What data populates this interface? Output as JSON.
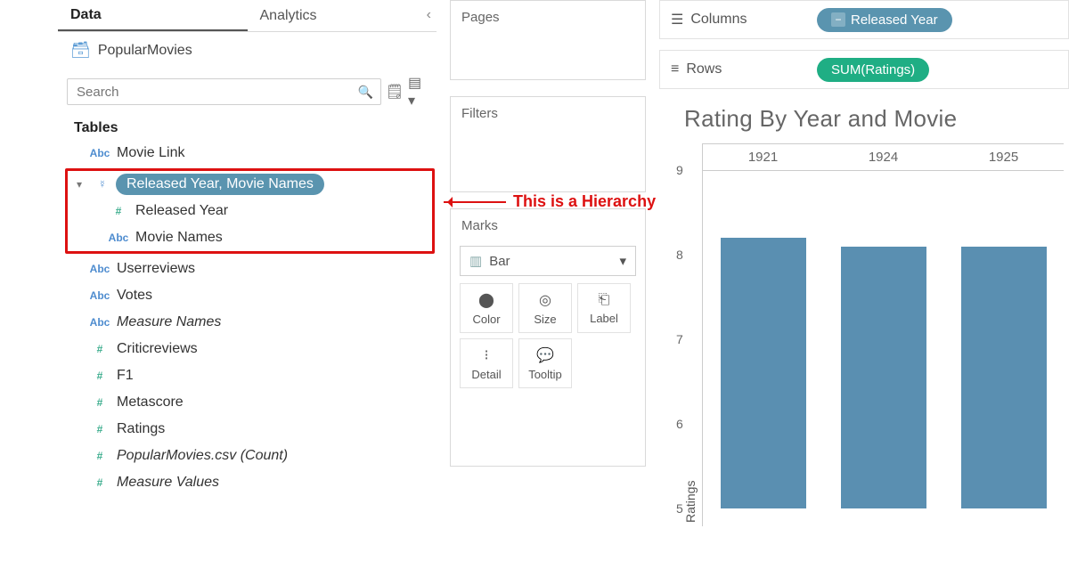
{
  "sidebar": {
    "tabs": {
      "data": "Data",
      "analytics": "Analytics"
    },
    "datasource": "PopularMovies",
    "search_placeholder": "Search",
    "section": "Tables",
    "fields": [
      {
        "type": "abc",
        "label": "Movie Link"
      },
      {
        "type": "hier",
        "label": "Released Year, Movie Names",
        "selected": true
      },
      {
        "type": "num",
        "label": "Released Year",
        "child": true
      },
      {
        "type": "abc",
        "label": "Movie Names",
        "child": true
      },
      {
        "type": "abc",
        "label": "Userreviews"
      },
      {
        "type": "abc",
        "label": "Votes"
      },
      {
        "type": "abc",
        "label": "Measure Names",
        "italic": true
      },
      {
        "type": "num",
        "label": "Criticreviews"
      },
      {
        "type": "num",
        "label": "F1"
      },
      {
        "type": "num",
        "label": "Metascore"
      },
      {
        "type": "num",
        "label": "Ratings"
      },
      {
        "type": "num",
        "label": "PopularMovies.csv (Count)",
        "italic": true
      },
      {
        "type": "num",
        "label": "Measure Values",
        "italic": true
      }
    ]
  },
  "shelves": {
    "pages": "Pages",
    "filters": "Filters",
    "marks": "Marks",
    "mark_type": "Bar",
    "cards": {
      "color": "Color",
      "size": "Size",
      "label": "Label",
      "detail": "Detail",
      "tooltip": "Tooltip"
    }
  },
  "top": {
    "columns_label": "Columns",
    "rows_label": "Rows",
    "columns_pill": "Released Year",
    "rows_pill": "SUM(Ratings)"
  },
  "annotation": "This is a Hierarchy",
  "chart_data": {
    "type": "bar",
    "title": "Rating By Year and Movie",
    "ylabel": "Ratings",
    "categories": [
      "1921",
      "1924",
      "1925"
    ],
    "values": [
      8.2,
      8.1,
      8.1
    ],
    "ylim": [
      5,
      9
    ],
    "yticks": [
      5,
      6,
      7,
      8,
      9
    ]
  }
}
